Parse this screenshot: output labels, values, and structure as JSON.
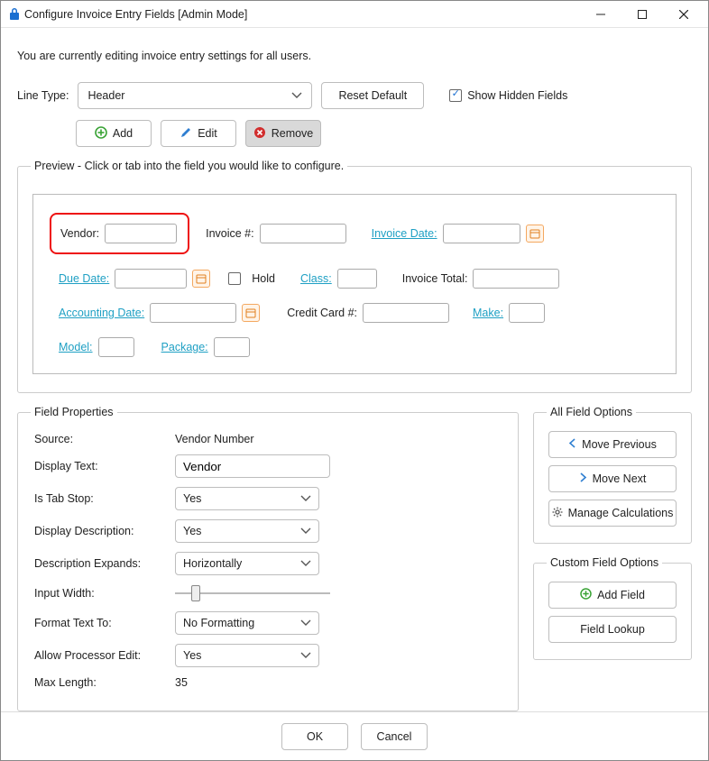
{
  "title": "Configure Invoice Entry Fields [Admin Mode]",
  "info": "You are currently editing invoice entry settings for all users.",
  "line_type": {
    "label": "Line Type:",
    "value": "Header"
  },
  "reset_default": "Reset Default",
  "show_hidden": {
    "label": "Show Hidden Fields",
    "checked": true
  },
  "toolbar": {
    "add": "Add",
    "edit": "Edit",
    "remove": "Remove"
  },
  "preview": {
    "legend": "Preview - Click or tab into the field you would like to configure.",
    "fields": {
      "vendor": "Vendor:",
      "invoice_num": "Invoice #:",
      "invoice_date": "Invoice Date:",
      "due_date": "Due Date:",
      "hold": "Hold",
      "class": "Class:",
      "invoice_total": "Invoice Total:",
      "accounting_date": "Accounting Date:",
      "credit_card": "Credit Card #:",
      "make": "Make:",
      "model": "Model:",
      "package": "Package:"
    }
  },
  "field_props": {
    "legend": "Field Properties",
    "source_label": "Source:",
    "source_value": "Vendor Number",
    "display_text_label": "Display Text:",
    "display_text_value": "Vendor",
    "tab_stop_label": "Is Tab Stop:",
    "tab_stop_value": "Yes",
    "display_desc_label": "Display Description:",
    "display_desc_value": "Yes",
    "desc_expands_label": "Description Expands:",
    "desc_expands_value": "Horizontally",
    "input_width_label": "Input Width:",
    "format_label": "Format Text To:",
    "format_value": "No Formatting",
    "allow_edit_label": "Allow Processor Edit:",
    "allow_edit_value": "Yes",
    "max_length_label": "Max Length:",
    "max_length_value": "35"
  },
  "all_field_options": {
    "legend": "All Field Options",
    "move_prev": "Move Previous",
    "move_next": "Move Next",
    "manage_calc": "Manage Calculations"
  },
  "custom_field_options": {
    "legend": "Custom Field Options",
    "add_field": "Add Field",
    "field_lookup": "Field Lookup"
  },
  "footer": {
    "ok": "OK",
    "cancel": "Cancel"
  },
  "colors": {
    "link": "#1fa0c4",
    "add": "#3aa336",
    "remove": "#d12d2d",
    "edit": "#2f7fd1"
  }
}
